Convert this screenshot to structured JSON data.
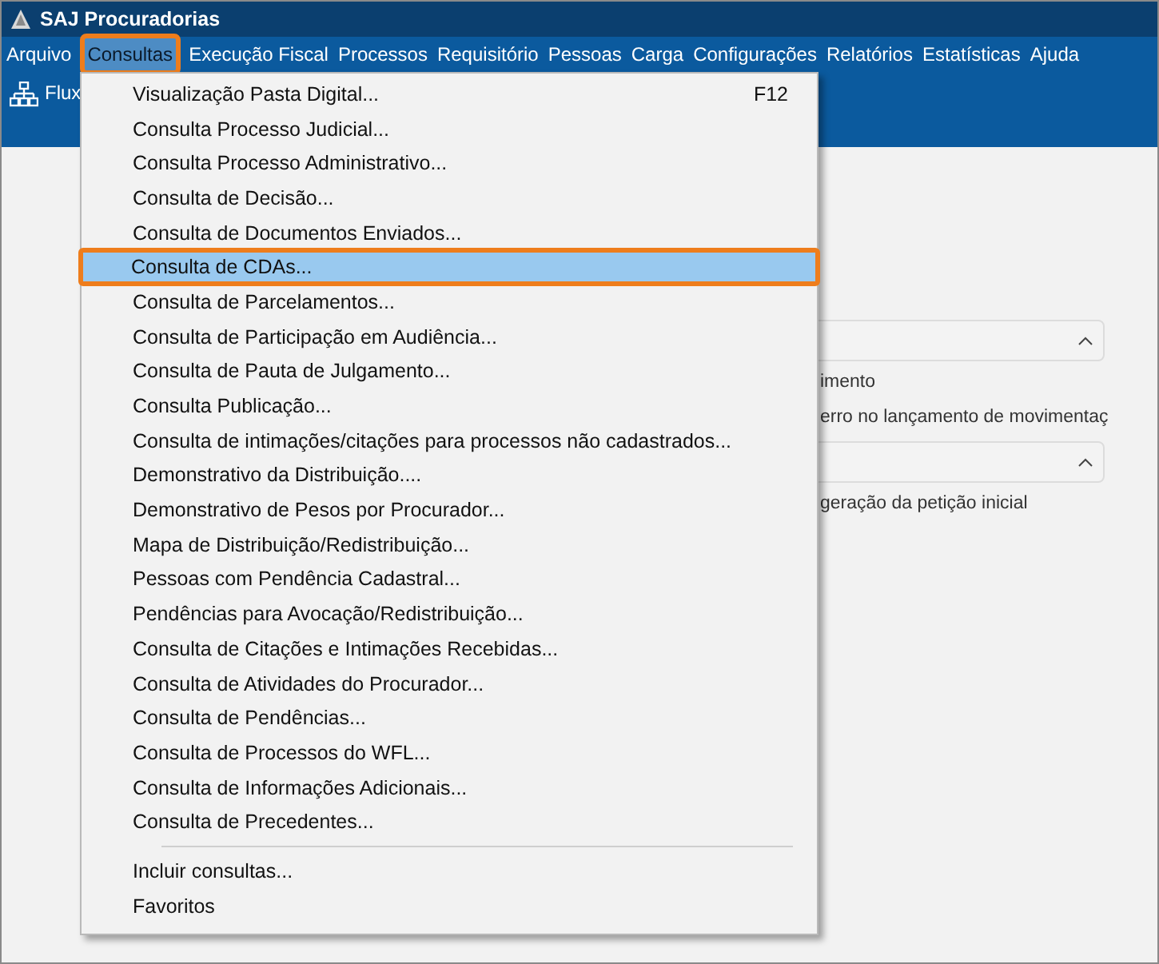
{
  "window": {
    "title": "SAJ Procuradorias"
  },
  "menu_bar": [
    {
      "label": "Arquivo",
      "selected": false
    },
    {
      "label": "Consultas",
      "selected": true
    },
    {
      "label": "Execução Fiscal",
      "selected": false
    },
    {
      "label": "Processos",
      "selected": false
    },
    {
      "label": "Requisitório",
      "selected": false
    },
    {
      "label": "Pessoas",
      "selected": false
    },
    {
      "label": "Carga",
      "selected": false
    },
    {
      "label": "Configurações",
      "selected": false
    },
    {
      "label": "Relatórios",
      "selected": false
    },
    {
      "label": "Estatísticas",
      "selected": false
    },
    {
      "label": "Ajuda",
      "selected": false
    }
  ],
  "toolbar": {
    "label": "Flux"
  },
  "dropdown": {
    "groups": [
      [
        {
          "label": "Visualização Pasta Digital...",
          "shortcut": "F12",
          "selected": false
        },
        {
          "label": "Consulta Processo Judicial...",
          "selected": false
        },
        {
          "label": "Consulta Processo Administrativo...",
          "selected": false
        },
        {
          "label": "Consulta de Decisão...",
          "selected": false
        },
        {
          "label": "Consulta de Documentos Enviados...",
          "selected": false
        },
        {
          "label": "Consulta de CDAs...",
          "selected": true
        },
        {
          "label": "Consulta de Parcelamentos...",
          "selected": false
        },
        {
          "label": "Consulta de Participação em Audiência...",
          "selected": false
        },
        {
          "label": "Consulta de Pauta de Julgamento...",
          "selected": false
        },
        {
          "label": "Consulta Publicação...",
          "selected": false
        },
        {
          "label": "Consulta de intimações/citações para processos não cadastrados...",
          "selected": false
        },
        {
          "label": "Demonstrativo da Distribuição....",
          "selected": false
        },
        {
          "label": "Demonstrativo de Pesos por Procurador...",
          "selected": false
        },
        {
          "label": "Mapa de Distribuição/Redistribuição...",
          "selected": false
        },
        {
          "label": "Pessoas com Pendência Cadastral...",
          "selected": false
        },
        {
          "label": "Pendências para Avocação/Redistribuição...",
          "selected": false
        },
        {
          "label": "Consulta de Citações e Intimações Recebidas...",
          "selected": false
        },
        {
          "label": "Consulta de Atividades do Procurador...",
          "selected": false
        },
        {
          "label": "Consulta de Pendências...",
          "selected": false
        },
        {
          "label": "Consulta de Processos do WFL...",
          "selected": false
        },
        {
          "label": "Consulta de Informações Adicionais...",
          "selected": false
        },
        {
          "label": "Consulta de Precedentes...",
          "selected": false
        }
      ],
      [
        {
          "label": "Incluir consultas...",
          "selected": false
        },
        {
          "label": "Favoritos",
          "selected": false
        }
      ]
    ]
  },
  "sections": [
    {
      "expanded": true,
      "lines": [
        "imento",
        "erro no lançamento de movimentaç"
      ]
    },
    {
      "expanded": true,
      "lines": [
        "geração da petição inicial"
      ]
    }
  ]
}
